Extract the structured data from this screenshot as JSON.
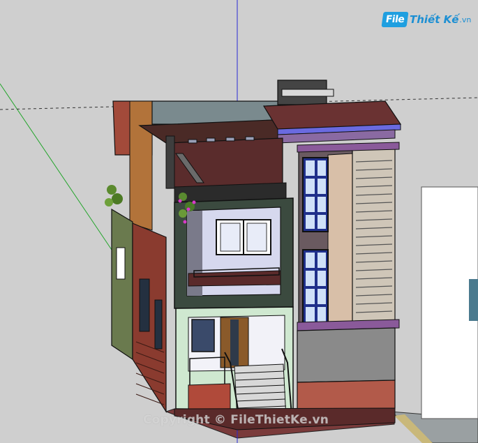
{
  "logo": {
    "badge": "File",
    "name": "Thiết Kế",
    "tld": ".vn"
  },
  "watermark": "Copyright © FileThietKe.vn",
  "colors": {
    "background": "#cfcfcf",
    "blue_axis": "#2a2ad6",
    "green_axis": "#22a52a",
    "brand": "#1f9fe0"
  }
}
